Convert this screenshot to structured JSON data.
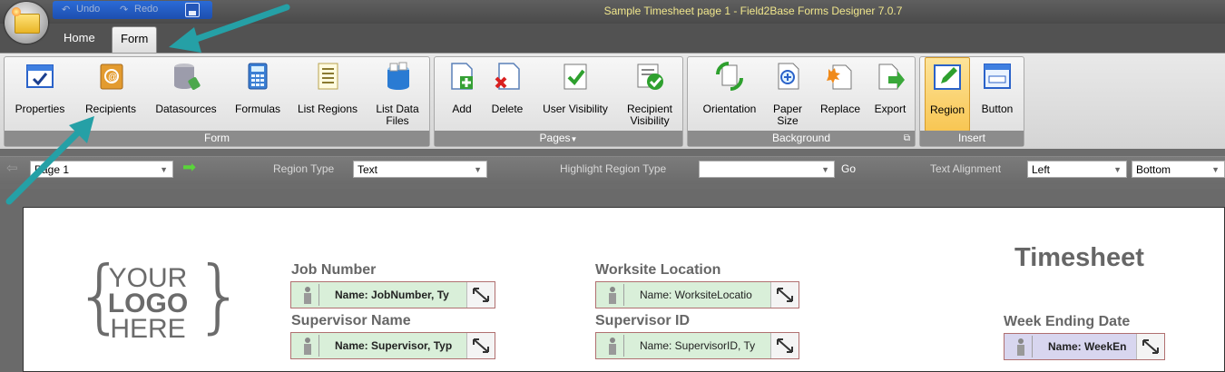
{
  "window": {
    "title": "Sample Timesheet page 1 - Field2Base Forms Designer 7.0.7"
  },
  "quick_access": {
    "undo_label": "Undo",
    "redo_label": "Redo"
  },
  "tabs": [
    {
      "label": "Home"
    },
    {
      "label": "Form"
    }
  ],
  "ribbon": {
    "groups": [
      {
        "label": "Form",
        "buttons": [
          {
            "label": "Properties"
          },
          {
            "label": "Recipients"
          },
          {
            "label": "Datasources"
          },
          {
            "label": "Formulas"
          },
          {
            "label": "List Regions"
          },
          {
            "label": "List Data\nFiles"
          }
        ]
      },
      {
        "label": "Pages",
        "buttons": [
          {
            "label": "Add"
          },
          {
            "label": "Delete"
          },
          {
            "label": "User Visibility"
          },
          {
            "label": "Recipient\nVisibility"
          }
        ]
      },
      {
        "label": "Background",
        "buttons": [
          {
            "label": "Orientation"
          },
          {
            "label": "Paper\nSize"
          },
          {
            "label": "Replace"
          },
          {
            "label": "Export"
          }
        ]
      },
      {
        "label": "Insert",
        "buttons": [
          {
            "label": "Region"
          },
          {
            "label": "Button"
          }
        ]
      }
    ]
  },
  "toolbar": {
    "page_select": "Page 1",
    "region_type_label": "Region Type",
    "region_type_value": "Text",
    "highlight_label": "Highlight Region Type",
    "highlight_value": "",
    "go_label": "Go",
    "text_alignment_label": "Text Alignment",
    "h_align_value": "Left",
    "v_align_value": "Bottom"
  },
  "form": {
    "logo": {
      "line1": "YOUR",
      "line2": "LOGO",
      "line3": "HERE"
    },
    "title": "Timesheet",
    "labels": {
      "job_number": "Job Number",
      "supervisor_name": "Supervisor Name",
      "worksite_location": "Worksite Location",
      "supervisor_id": "Supervisor ID",
      "week_ending": "Week Ending Date"
    },
    "fields": {
      "job_number": "Name: JobNumber, Ty",
      "supervisor": "Name: Supervisor, Typ",
      "worksite": "Name: WorksiteLocatio",
      "supervisor_id": "Name: SupervisorID, Ty",
      "week_ending": "Name: WeekEn"
    }
  },
  "colors": {
    "accent_arrow": "#25a0a6",
    "field_green": "#d9efd9",
    "field_purple": "#d8d6ef",
    "title_text": "#f0e68c"
  }
}
